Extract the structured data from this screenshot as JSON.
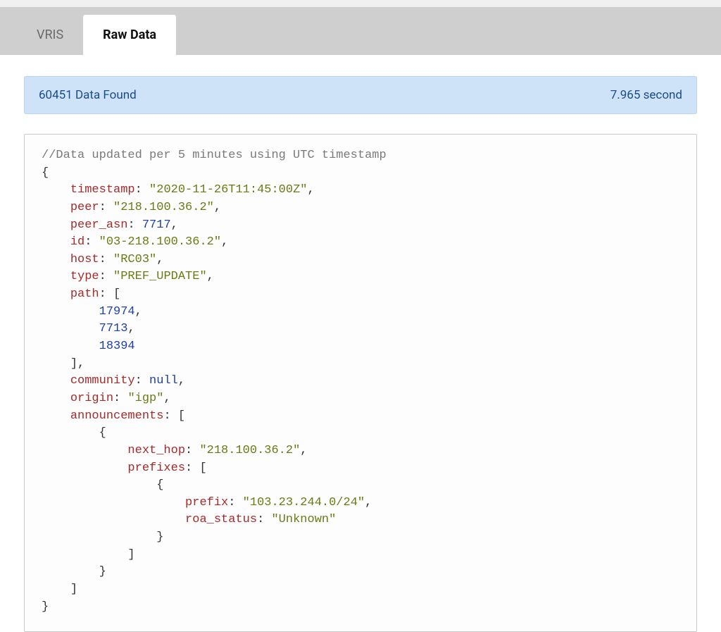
{
  "tabs": {
    "vris": "VRIS",
    "raw": "Raw Data"
  },
  "status": {
    "left": "60451 Data Found",
    "right": "7.965 second"
  },
  "code": {
    "comment": "//Data updated per 5 minutes using UTC timestamp",
    "indent": "    ",
    "obj": {
      "timestamp": "2020-11-26T11:45:00Z",
      "peer": "218.100.36.2",
      "peer_asn": 7717,
      "id": "03-218.100.36.2",
      "host": "RC03",
      "type": "PREF_UPDATE",
      "path": [
        17974,
        7713,
        18394
      ],
      "community": null,
      "origin": "igp",
      "announcements": [
        {
          "next_hop": "218.100.36.2",
          "prefixes": [
            {
              "prefix": "103.23.244.0/24",
              "roa_status": "Unknown"
            }
          ]
        }
      ]
    }
  }
}
